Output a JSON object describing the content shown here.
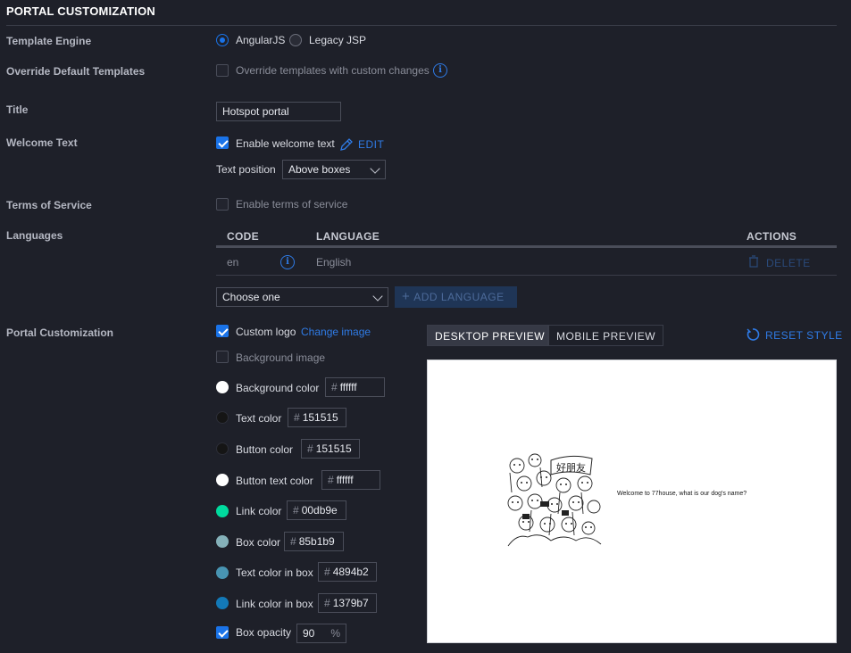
{
  "header": {
    "title": "PORTAL CUSTOMIZATION"
  },
  "template_engine": {
    "label": "Template Engine",
    "options": [
      "AngularJS",
      "Legacy JSP"
    ],
    "selected": "AngularJS"
  },
  "override": {
    "label": "Override Default Templates",
    "checkbox_label": "Override templates with custom changes",
    "checked": false
  },
  "title_field": {
    "label": "Title",
    "value": "Hotspot portal"
  },
  "welcome": {
    "label": "Welcome Text",
    "checkbox_label": "Enable welcome text",
    "checked": true,
    "edit_label": "EDIT",
    "position_label": "Text position",
    "position_value": "Above boxes"
  },
  "tos": {
    "label": "Terms of Service",
    "checkbox_label": "Enable terms of service",
    "checked": false
  },
  "languages": {
    "label": "Languages",
    "columns": [
      "CODE",
      "LANGUAGE",
      "ACTIONS"
    ],
    "rows": [
      {
        "code": "en",
        "language": "English",
        "action": "DELETE"
      }
    ],
    "select_placeholder": "Choose one",
    "add_label": "ADD LANGUAGE"
  },
  "portal": {
    "label": "Portal Customization",
    "custom_logo": {
      "label": "Custom logo",
      "checked": true,
      "link": "Change image"
    },
    "background_image": {
      "label": "Background image",
      "checked": false
    },
    "colors": [
      {
        "label": "Background color",
        "hex": "ffffff",
        "swatch": "#ffffff"
      },
      {
        "label": "Text color",
        "hex": "151515",
        "swatch": "#151515"
      },
      {
        "label": "Button color",
        "hex": "151515",
        "swatch": "#151515"
      },
      {
        "label": "Button text color",
        "hex": "ffffff",
        "swatch": "#ffffff"
      },
      {
        "label": "Link color",
        "hex": "00db9e",
        "swatch": "#00db9e"
      },
      {
        "label": "Box color",
        "hex": "85b1b9",
        "swatch": "#85b1b9"
      },
      {
        "label": "Text color in box",
        "hex": "4894b2",
        "swatch": "#4894b2"
      },
      {
        "label": "Link color in box",
        "hex": "1379b7",
        "swatch": "#1379b7"
      }
    ],
    "hash_symbol": "#",
    "box_opacity": {
      "label": "Box opacity",
      "checked": true,
      "value": "90",
      "unit": "%"
    }
  },
  "preview": {
    "tabs": [
      "DESKTOP PREVIEW",
      "MOBILE PREVIEW"
    ],
    "active_tab": "DESKTOP PREVIEW",
    "reset_label": "RESET STYLE",
    "logo_text": "好朋友",
    "welcome_text": "Welcome to 77house, what is our dog's name?"
  },
  "colors": {
    "accent": "#1a73e8",
    "background": "#1e2029"
  }
}
